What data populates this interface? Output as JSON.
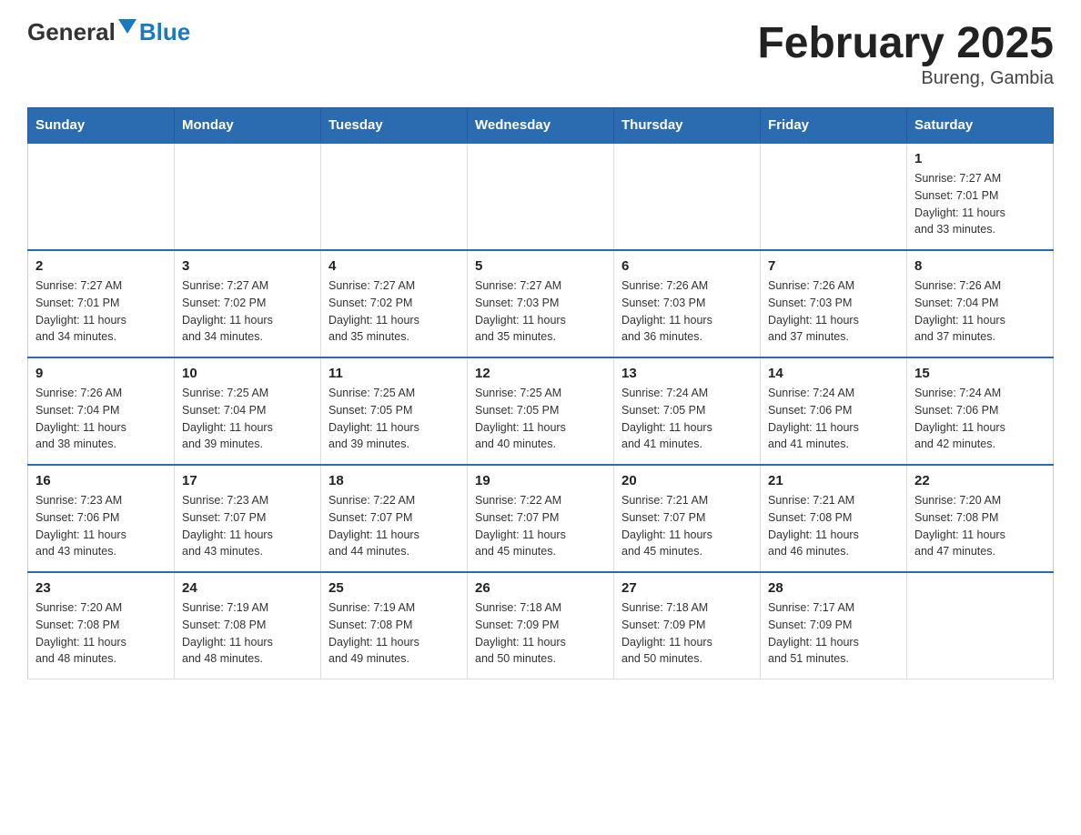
{
  "logo": {
    "text_general": "General",
    "text_blue": "Blue"
  },
  "title": "February 2025",
  "subtitle": "Bureng, Gambia",
  "days_of_week": [
    "Sunday",
    "Monday",
    "Tuesday",
    "Wednesday",
    "Thursday",
    "Friday",
    "Saturday"
  ],
  "weeks": [
    [
      {
        "day": "",
        "info": ""
      },
      {
        "day": "",
        "info": ""
      },
      {
        "day": "",
        "info": ""
      },
      {
        "day": "",
        "info": ""
      },
      {
        "day": "",
        "info": ""
      },
      {
        "day": "",
        "info": ""
      },
      {
        "day": "1",
        "info": "Sunrise: 7:27 AM\nSunset: 7:01 PM\nDaylight: 11 hours\nand 33 minutes."
      }
    ],
    [
      {
        "day": "2",
        "info": "Sunrise: 7:27 AM\nSunset: 7:01 PM\nDaylight: 11 hours\nand 34 minutes."
      },
      {
        "day": "3",
        "info": "Sunrise: 7:27 AM\nSunset: 7:02 PM\nDaylight: 11 hours\nand 34 minutes."
      },
      {
        "day": "4",
        "info": "Sunrise: 7:27 AM\nSunset: 7:02 PM\nDaylight: 11 hours\nand 35 minutes."
      },
      {
        "day": "5",
        "info": "Sunrise: 7:27 AM\nSunset: 7:03 PM\nDaylight: 11 hours\nand 35 minutes."
      },
      {
        "day": "6",
        "info": "Sunrise: 7:26 AM\nSunset: 7:03 PM\nDaylight: 11 hours\nand 36 minutes."
      },
      {
        "day": "7",
        "info": "Sunrise: 7:26 AM\nSunset: 7:03 PM\nDaylight: 11 hours\nand 37 minutes."
      },
      {
        "day": "8",
        "info": "Sunrise: 7:26 AM\nSunset: 7:04 PM\nDaylight: 11 hours\nand 37 minutes."
      }
    ],
    [
      {
        "day": "9",
        "info": "Sunrise: 7:26 AM\nSunset: 7:04 PM\nDaylight: 11 hours\nand 38 minutes."
      },
      {
        "day": "10",
        "info": "Sunrise: 7:25 AM\nSunset: 7:04 PM\nDaylight: 11 hours\nand 39 minutes."
      },
      {
        "day": "11",
        "info": "Sunrise: 7:25 AM\nSunset: 7:05 PM\nDaylight: 11 hours\nand 39 minutes."
      },
      {
        "day": "12",
        "info": "Sunrise: 7:25 AM\nSunset: 7:05 PM\nDaylight: 11 hours\nand 40 minutes."
      },
      {
        "day": "13",
        "info": "Sunrise: 7:24 AM\nSunset: 7:05 PM\nDaylight: 11 hours\nand 41 minutes."
      },
      {
        "day": "14",
        "info": "Sunrise: 7:24 AM\nSunset: 7:06 PM\nDaylight: 11 hours\nand 41 minutes."
      },
      {
        "day": "15",
        "info": "Sunrise: 7:24 AM\nSunset: 7:06 PM\nDaylight: 11 hours\nand 42 minutes."
      }
    ],
    [
      {
        "day": "16",
        "info": "Sunrise: 7:23 AM\nSunset: 7:06 PM\nDaylight: 11 hours\nand 43 minutes."
      },
      {
        "day": "17",
        "info": "Sunrise: 7:23 AM\nSunset: 7:07 PM\nDaylight: 11 hours\nand 43 minutes."
      },
      {
        "day": "18",
        "info": "Sunrise: 7:22 AM\nSunset: 7:07 PM\nDaylight: 11 hours\nand 44 minutes."
      },
      {
        "day": "19",
        "info": "Sunrise: 7:22 AM\nSunset: 7:07 PM\nDaylight: 11 hours\nand 45 minutes."
      },
      {
        "day": "20",
        "info": "Sunrise: 7:21 AM\nSunset: 7:07 PM\nDaylight: 11 hours\nand 45 minutes."
      },
      {
        "day": "21",
        "info": "Sunrise: 7:21 AM\nSunset: 7:08 PM\nDaylight: 11 hours\nand 46 minutes."
      },
      {
        "day": "22",
        "info": "Sunrise: 7:20 AM\nSunset: 7:08 PM\nDaylight: 11 hours\nand 47 minutes."
      }
    ],
    [
      {
        "day": "23",
        "info": "Sunrise: 7:20 AM\nSunset: 7:08 PM\nDaylight: 11 hours\nand 48 minutes."
      },
      {
        "day": "24",
        "info": "Sunrise: 7:19 AM\nSunset: 7:08 PM\nDaylight: 11 hours\nand 48 minutes."
      },
      {
        "day": "25",
        "info": "Sunrise: 7:19 AM\nSunset: 7:08 PM\nDaylight: 11 hours\nand 49 minutes."
      },
      {
        "day": "26",
        "info": "Sunrise: 7:18 AM\nSunset: 7:09 PM\nDaylight: 11 hours\nand 50 minutes."
      },
      {
        "day": "27",
        "info": "Sunrise: 7:18 AM\nSunset: 7:09 PM\nDaylight: 11 hours\nand 50 minutes."
      },
      {
        "day": "28",
        "info": "Sunrise: 7:17 AM\nSunset: 7:09 PM\nDaylight: 11 hours\nand 51 minutes."
      },
      {
        "day": "",
        "info": ""
      }
    ]
  ]
}
